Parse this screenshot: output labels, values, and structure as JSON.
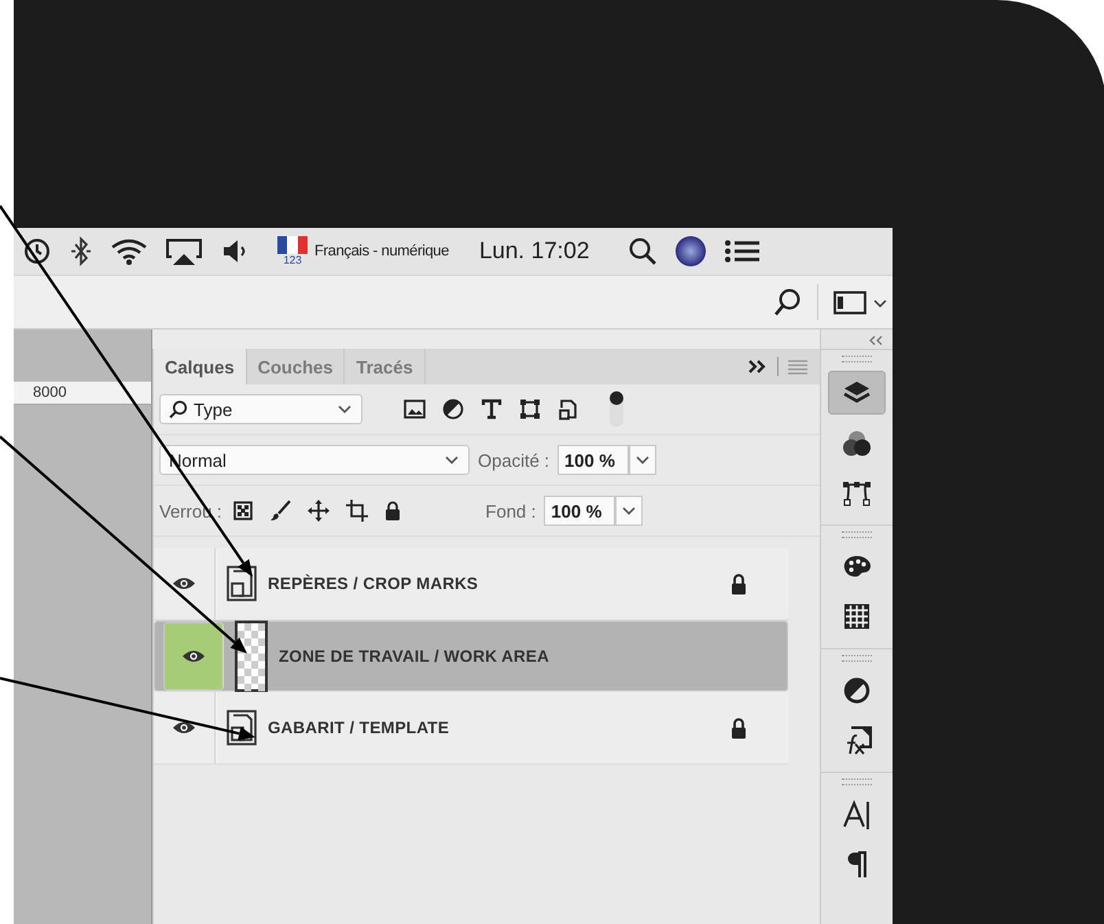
{
  "menu_bar": {
    "input_source": "Français - numérique",
    "input_source_number": "123",
    "clock": "Lun. 17:02"
  },
  "ruler": {
    "label": "8000"
  },
  "layers_panel": {
    "tabs": [
      {
        "label": "Calques",
        "selected": true
      },
      {
        "label": "Couches",
        "selected": false
      },
      {
        "label": "Tracés",
        "selected": false
      }
    ],
    "filter": {
      "value": "Type",
      "on": true
    },
    "blend_mode": {
      "value": "Normal"
    },
    "opacity": {
      "label": "Opacité :",
      "value": "100 %"
    },
    "lock": {
      "label": "Verrou :"
    },
    "fill": {
      "label": "Fond :",
      "value": "100 %"
    },
    "layers": [
      {
        "name": "REPÈRES / CROP MARKS",
        "kind": "smart",
        "visible": true,
        "selected": false,
        "locked": true
      },
      {
        "name": "ZONE DE TRAVAIL / WORK AREA",
        "kind": "pixel",
        "visible": true,
        "selected": true,
        "locked": false
      },
      {
        "name": "GABARIT / TEMPLATE",
        "kind": "smart",
        "visible": true,
        "selected": false,
        "locked": true
      }
    ]
  },
  "dock_buttons": [
    {
      "selected": true
    },
    {
      "selected": false
    },
    {
      "selected": false
    },
    {
      "selected": false
    },
    {
      "selected": false
    },
    {
      "selected": false
    },
    {
      "selected": false
    },
    {
      "selected": false
    },
    {
      "selected": false
    }
  ]
}
